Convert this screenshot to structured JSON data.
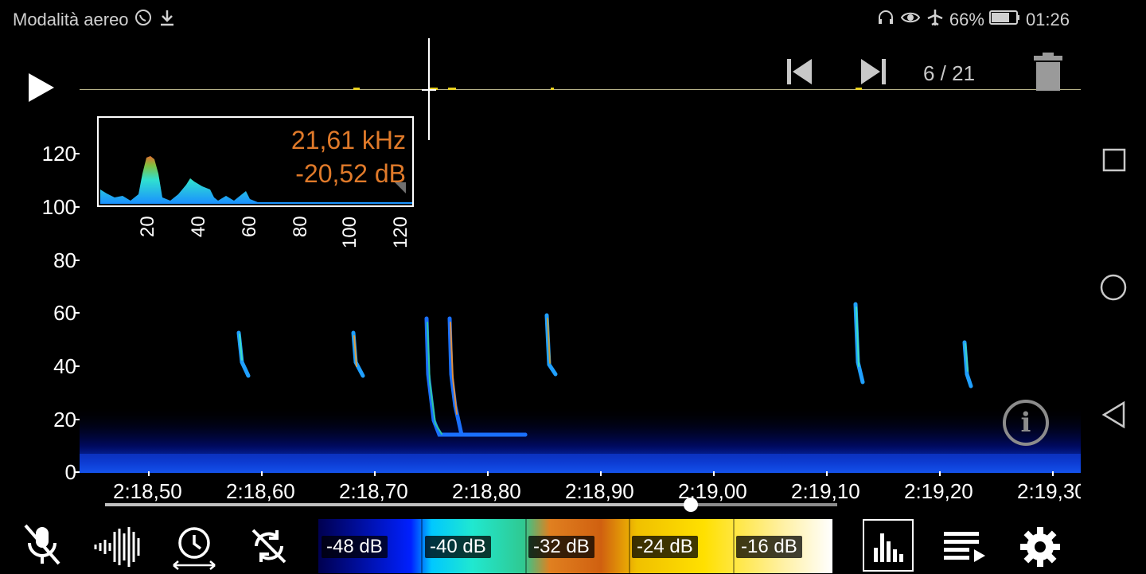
{
  "status_bar": {
    "left_text": "Modalità aereo",
    "battery": "66%",
    "time": "01:26"
  },
  "player": {
    "counter": "6 / 21"
  },
  "inset": {
    "frequency": "21,61 kHz",
    "level": "-20,52 dB",
    "x_ticks": [
      "20",
      "40",
      "60",
      "80",
      "100",
      "120"
    ]
  },
  "spectrogram": {
    "y_ticks": [
      "0",
      "20",
      "40",
      "60",
      "80",
      "100",
      "120"
    ],
    "x_ticks": [
      "2:18,50",
      "2:18,60",
      "2:18,70",
      "2:18,80",
      "2:18,90",
      "2:19,00",
      "2:19,10",
      "2:19,20",
      "2:19,30"
    ],
    "playback_progress": 0.8
  },
  "legend": {
    "levels": [
      "-48 dB",
      "-40 dB",
      "-32 dB",
      "-24 dB",
      "-16 dB"
    ]
  },
  "icons": {
    "mic": "mic-off-icon",
    "waveform": "waveform-icon",
    "clock": "clock-stretch-icon",
    "sync": "sync-off-icon",
    "histogram": "histogram-icon",
    "playlist": "playlist-icon",
    "settings": "gear-icon"
  }
}
